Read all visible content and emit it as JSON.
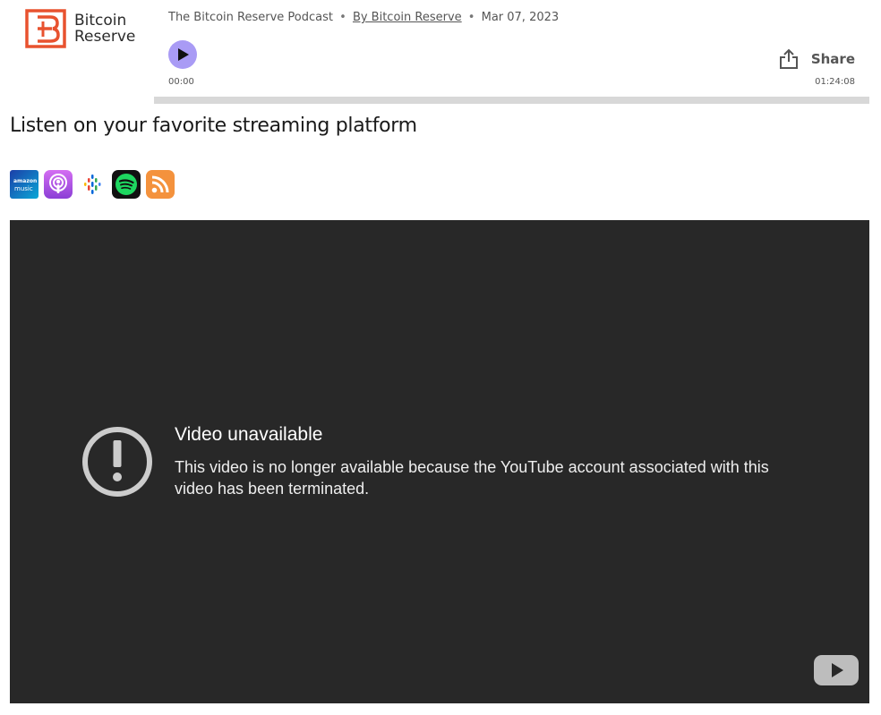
{
  "brand": {
    "name_line1": "Bitcoin",
    "name_line2": "Reserve",
    "accent_color": "#e8522f",
    "icon": "bitcoin-reserve-logo"
  },
  "player": {
    "show_title": "The Bitcoin Reserve Podcast",
    "separator": "•",
    "author_link": "By Bitcoin Reserve",
    "date": "Mar 07, 2023",
    "current_time": "00:00",
    "duration": "01:24:08",
    "progress": 0,
    "share_label": "Share",
    "play_icon": "play-icon",
    "share_icon": "share-icon",
    "accent_color": "#a99bf5"
  },
  "streaming": {
    "heading": "Listen on your favorite streaming platform",
    "platforms": [
      {
        "name": "Amazon Music",
        "icon": "amazon-music-icon",
        "line1": "amazon",
        "line2": "music"
      },
      {
        "name": "Apple Podcasts",
        "icon": "apple-podcasts-icon"
      },
      {
        "name": "Google Podcasts",
        "icon": "google-podcasts-icon"
      },
      {
        "name": "Spotify",
        "icon": "spotify-icon"
      },
      {
        "name": "RSS",
        "icon": "rss-icon"
      }
    ]
  },
  "video": {
    "title": "Video unavailable",
    "message": "This video is no longer available because the YouTube account associated with this video has been terminated.",
    "warning_icon": "exclamation-circle-icon",
    "logo_icon": "youtube-icon",
    "background_color": "#282828"
  }
}
